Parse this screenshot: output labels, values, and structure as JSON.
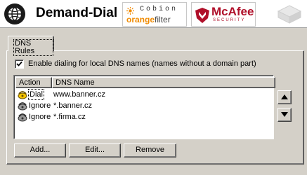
{
  "header": {
    "app_title": "Demand-Dial",
    "logos": {
      "app_logo_icon": "demand-dial-globe-icon",
      "cobion": {
        "line1": "Cobion",
        "line2_brand": "orange",
        "line2_suffix": "filter",
        "color": "#f08a00"
      },
      "mcafee": {
        "name": "McAfee",
        "tagline": "SECURITY",
        "color": "#b0102a"
      }
    }
  },
  "tabs": [
    {
      "label": "DNS Rules",
      "active": true
    }
  ],
  "options": {
    "enable_dialing_label": "Enable dialing for local DNS names (names without a domain part)",
    "enable_dialing_checked": true
  },
  "rules_table": {
    "columns": [
      "Action",
      "DNS Name"
    ],
    "rows": [
      {
        "action": "Dial",
        "dns_name": "www.banner.cz",
        "icon": "dial-icon",
        "selected": true
      },
      {
        "action": "Ignore",
        "dns_name": "*.banner.cz",
        "icon": "ignore-icon",
        "selected": false
      },
      {
        "action": "Ignore",
        "dns_name": "*.firma.cz",
        "icon": "ignore-icon",
        "selected": false
      }
    ]
  },
  "buttons": {
    "add": {
      "label": "Add...",
      "mnemonic": "A"
    },
    "edit": {
      "label": "Edit...",
      "mnemonic": "E"
    },
    "remove": {
      "label": "Remove",
      "mnemonic": "R"
    },
    "move_up_icon": "arrow-up-icon",
    "move_down_icon": "arrow-down-icon"
  },
  "colors": {
    "dialog_bg": "#d4d0c8",
    "cobion_orange": "#f08a00",
    "mcafee_red": "#b0102a"
  }
}
